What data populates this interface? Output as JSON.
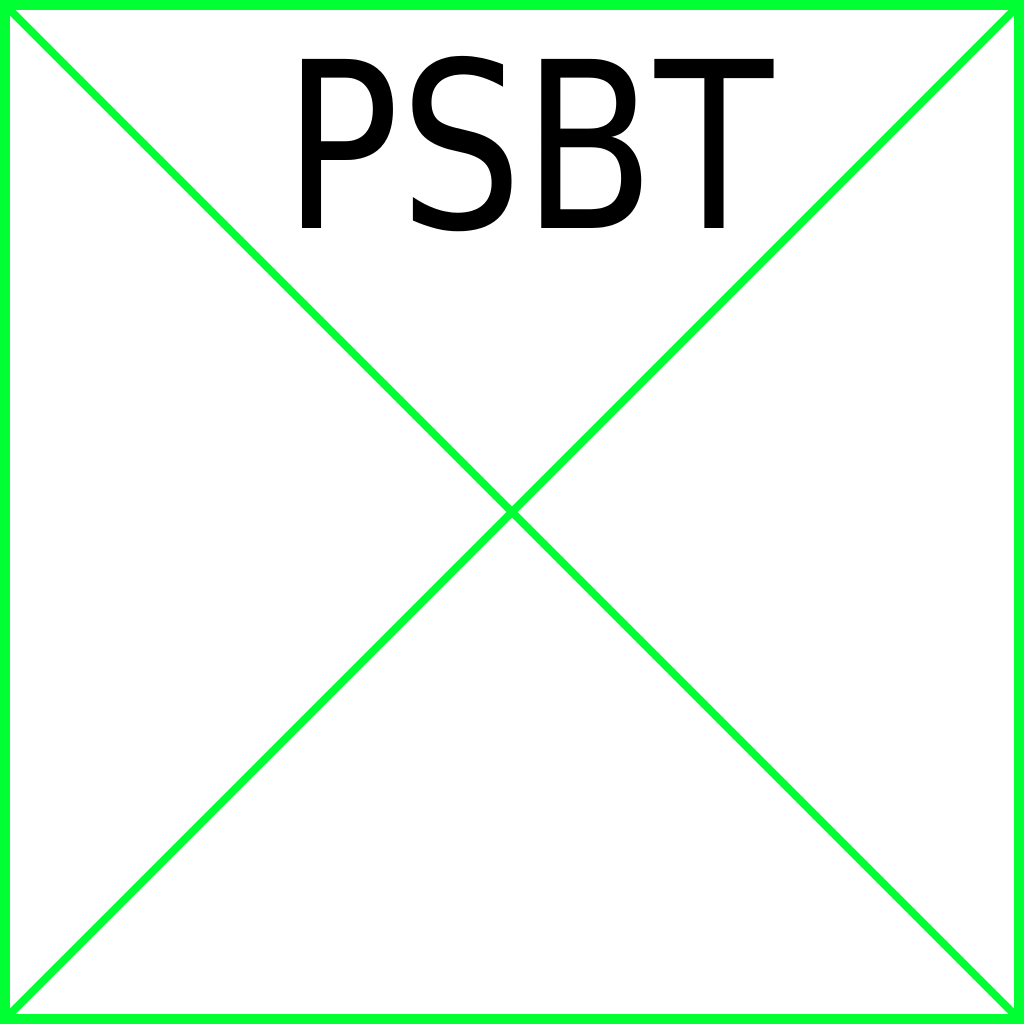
{
  "label": {
    "text": "PSBT"
  },
  "frame": {
    "stroke_color": "#00ff33",
    "fill_color": "#ffffff",
    "text_color": "#000000"
  }
}
